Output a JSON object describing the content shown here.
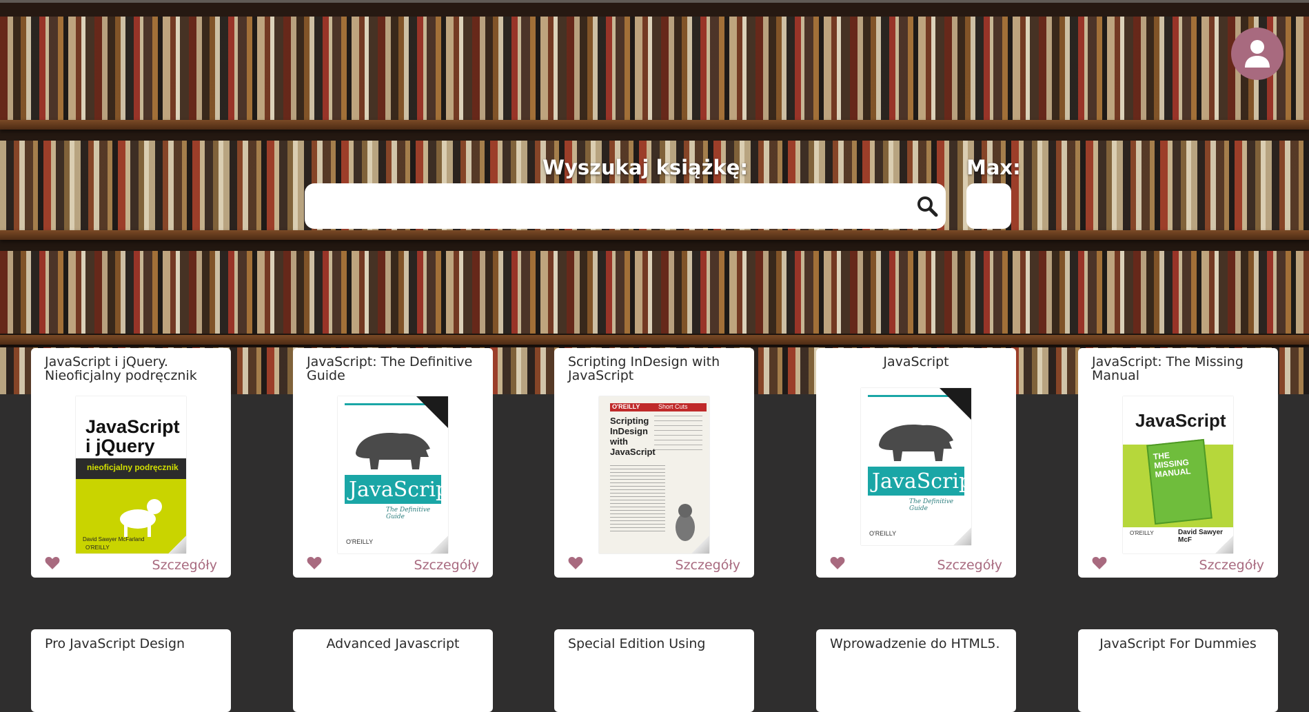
{
  "colors": {
    "accent": "#a86a7f",
    "page_bg": "#2f2e2e",
    "card_bg": "#ffffff"
  },
  "header": {
    "avatar_icon": "user-icon"
  },
  "search": {
    "label": "Wyszukaj książkę:",
    "value": "",
    "placeholder": "",
    "icon": "search-icon",
    "max_label": "Max:",
    "max_value": ""
  },
  "cards_row1": [
    {
      "title": "JavaScript i jQuery. Nieoficjalny podręcznik",
      "details": "Szczegóły",
      "cover_text": {
        "title": "JavaScript i jQuery",
        "band": "nieoficjalny podręcznik",
        "author": "David Sawyer McFarland",
        "publisher": "O'REILLY"
      }
    },
    {
      "title": "JavaScript: The Definitive Guide",
      "details": "Szczegóły",
      "cover_text": {
        "title": "JavaScript",
        "subtitle": "The Definitive Guide",
        "publisher": "O'REILLY"
      }
    },
    {
      "title": "Scripting InDesign with JavaScript",
      "details": "Szczegóły",
      "cover_text": {
        "publisher": "O'REILLY",
        "series": "Short Cuts",
        "title": "Scripting InDesign with JavaScript"
      }
    },
    {
      "title": "JavaScript",
      "details": "Szczegóły",
      "cover_text": {
        "title": "JavaScript",
        "subtitle": "The Definitive Guide",
        "publisher": "O'REILLY"
      }
    },
    {
      "title": "JavaScript: The Missing Manual",
      "details": "Szczegóły",
      "cover_text": {
        "title": "JavaScript",
        "badge": "THE MISSING MANUAL",
        "author": "David Sawyer McF",
        "publisher": "O'REILLY"
      }
    }
  ],
  "cards_row2": [
    {
      "title": "Pro JavaScript Design"
    },
    {
      "title": "Advanced Javascript"
    },
    {
      "title": "Special Edition Using"
    },
    {
      "title": "Wprowadzenie do HTML5."
    },
    {
      "title": "JavaScript For Dummies"
    }
  ]
}
